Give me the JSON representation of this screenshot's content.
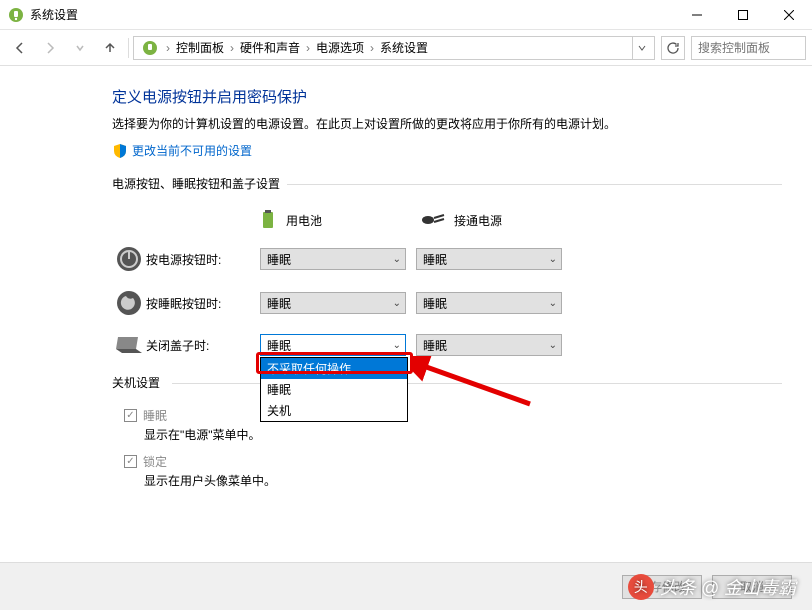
{
  "window": {
    "title": "系统设置"
  },
  "breadcrumb": {
    "items": [
      "控制面板",
      "硬件和声音",
      "电源选项",
      "系统设置"
    ]
  },
  "search": {
    "placeholder": "搜索控制面板"
  },
  "page": {
    "heading": "定义电源按钮并启用密码保护",
    "subtitle": "选择要为你的计算机设置的电源设置。在此页上对设置所做的更改将应用于你所有的电源计划。",
    "shield_link": "更改当前不可用的设置",
    "section1": "电源按钮、睡眠按钮和盖子设置",
    "section2": "关机设置",
    "col_battery": "用电池",
    "col_plugged": "接通电源"
  },
  "rows": [
    {
      "label": "按电源按钮时:",
      "battery": "睡眠",
      "plugged": "睡眠"
    },
    {
      "label": "按睡眠按钮时:",
      "battery": "睡眠",
      "plugged": "睡眠"
    },
    {
      "label": "关闭盖子时:",
      "battery": "睡眠",
      "plugged": "睡眠"
    }
  ],
  "dropdown_options": [
    "不采取任何操作",
    "睡眠",
    "关机"
  ],
  "shutdown": {
    "sleep_label": "睡眠",
    "sleep_sub": "显示在\"电源\"菜单中。",
    "lock_label": "锁定",
    "lock_sub": "显示在用户头像菜单中。"
  },
  "buttons": {
    "save": "保存修改",
    "cancel": "取消"
  },
  "watermark": "头条 @ 金山毒霸"
}
